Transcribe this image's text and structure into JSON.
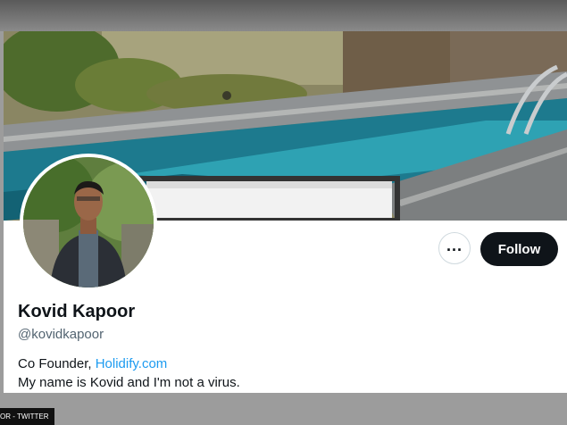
{
  "profile": {
    "display_name": "Kovid Kapoor",
    "handle": "@kovidkapoor",
    "bio_prefix": "Co Founder, ",
    "bio_link": "Holidify.com",
    "bio_line2": "My name is Kovid and I'm not a virus."
  },
  "actions": {
    "more_label": "...",
    "follow_label": "Follow"
  },
  "caption": {
    "text": "OR - TWITTER"
  },
  "colors": {
    "follow_bg": "#0f1419",
    "link": "#1d9bf0",
    "handle": "#536471"
  }
}
